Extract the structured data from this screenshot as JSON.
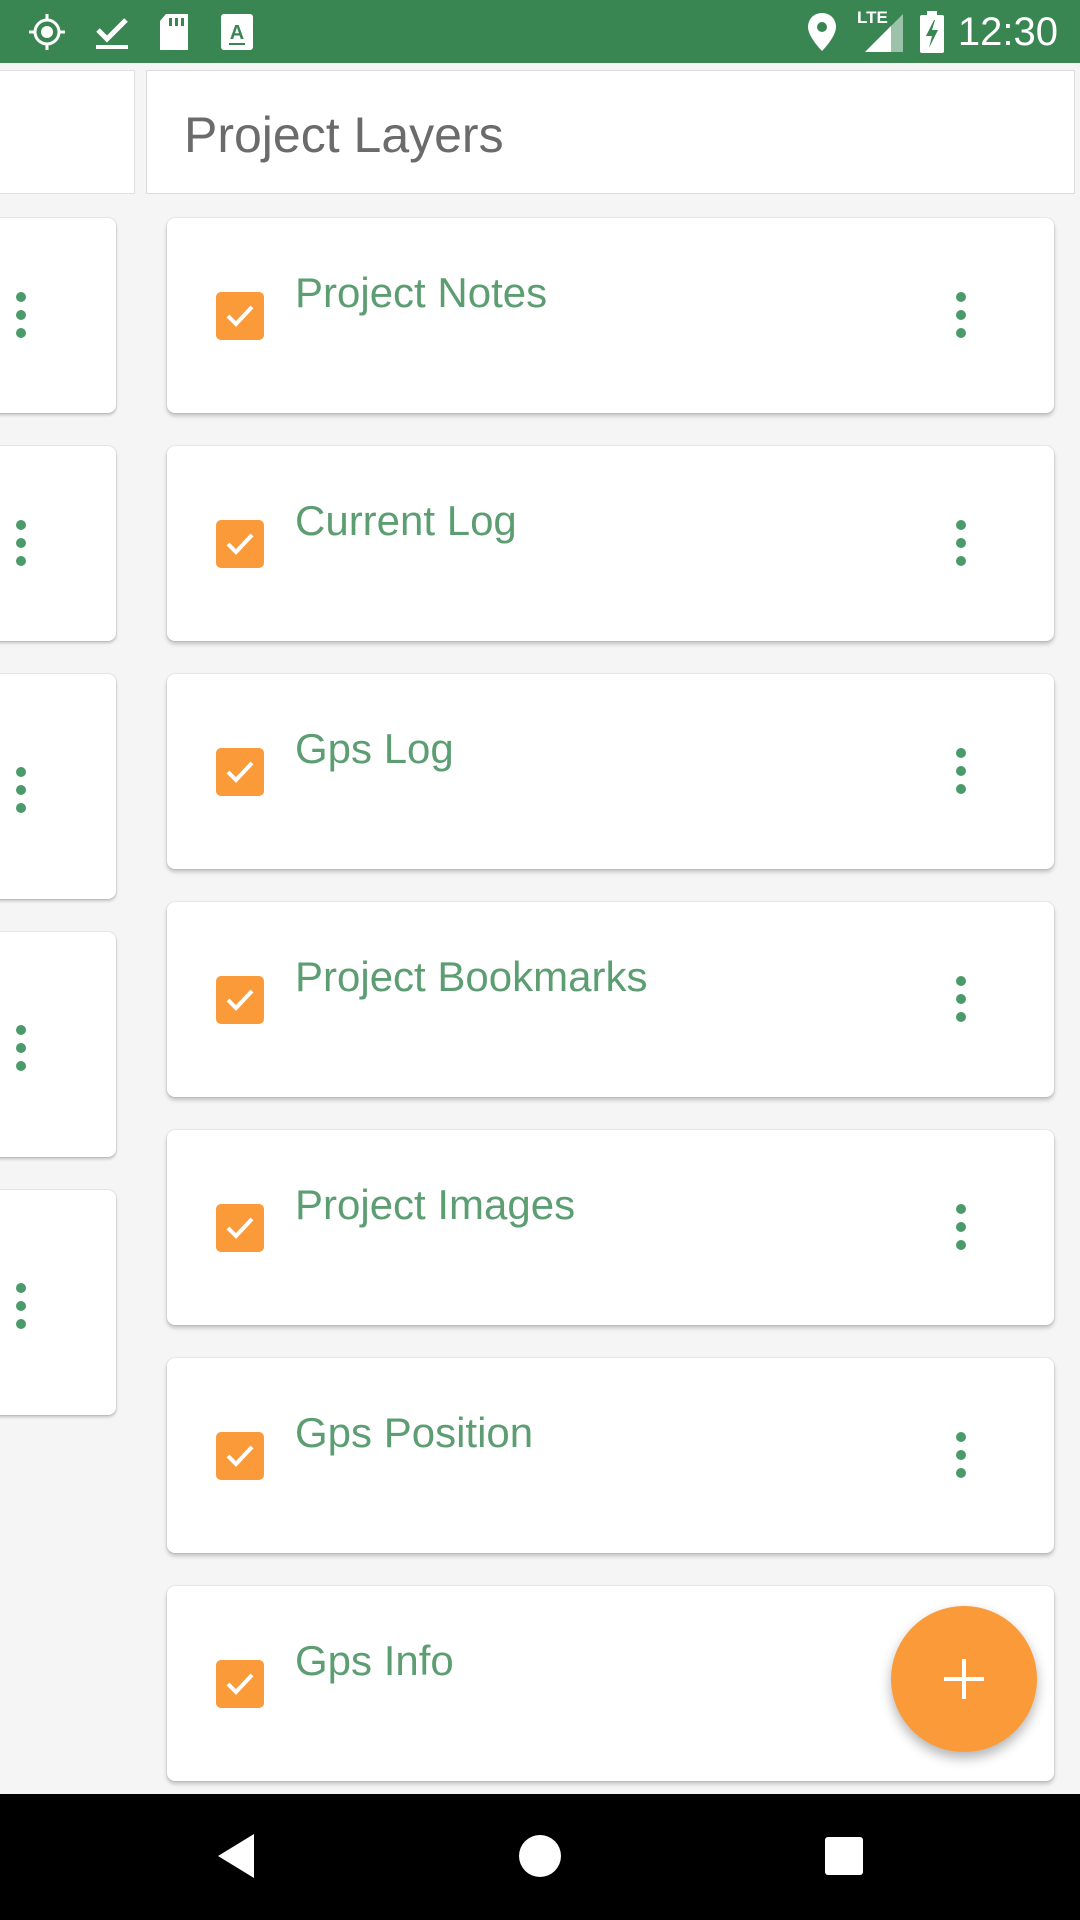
{
  "status_bar": {
    "time": "12:30",
    "network_label": "LTE",
    "background_color": "#398653",
    "left_icons": [
      "gps-icon",
      "download-done-icon",
      "sd-card-icon",
      "keyboard-a-icon"
    ],
    "right_icons": [
      "location-pin-icon",
      "signal-icon",
      "battery-charging-icon"
    ]
  },
  "right_panel": {
    "title": "Project Layers",
    "layers": [
      {
        "name": "Project Notes",
        "checked": true
      },
      {
        "name": "Current Log",
        "checked": true
      },
      {
        "name": "Gps Log",
        "checked": true
      },
      {
        "name": "Project Bookmarks",
        "checked": true
      },
      {
        "name": "Project Images",
        "checked": true
      },
      {
        "name": "Gps Position",
        "checked": true
      },
      {
        "name": "Gps Info",
        "checked": true
      }
    ]
  },
  "fab": {
    "icon": "plus-icon",
    "color": "#fb9a38"
  },
  "colors": {
    "accent": "#fb9a38",
    "layer_text": "#5c9e72",
    "kebab": "#4a9a6a"
  },
  "nav_bar": {
    "icons": [
      "back-icon",
      "home-icon",
      "recents-icon"
    ]
  }
}
